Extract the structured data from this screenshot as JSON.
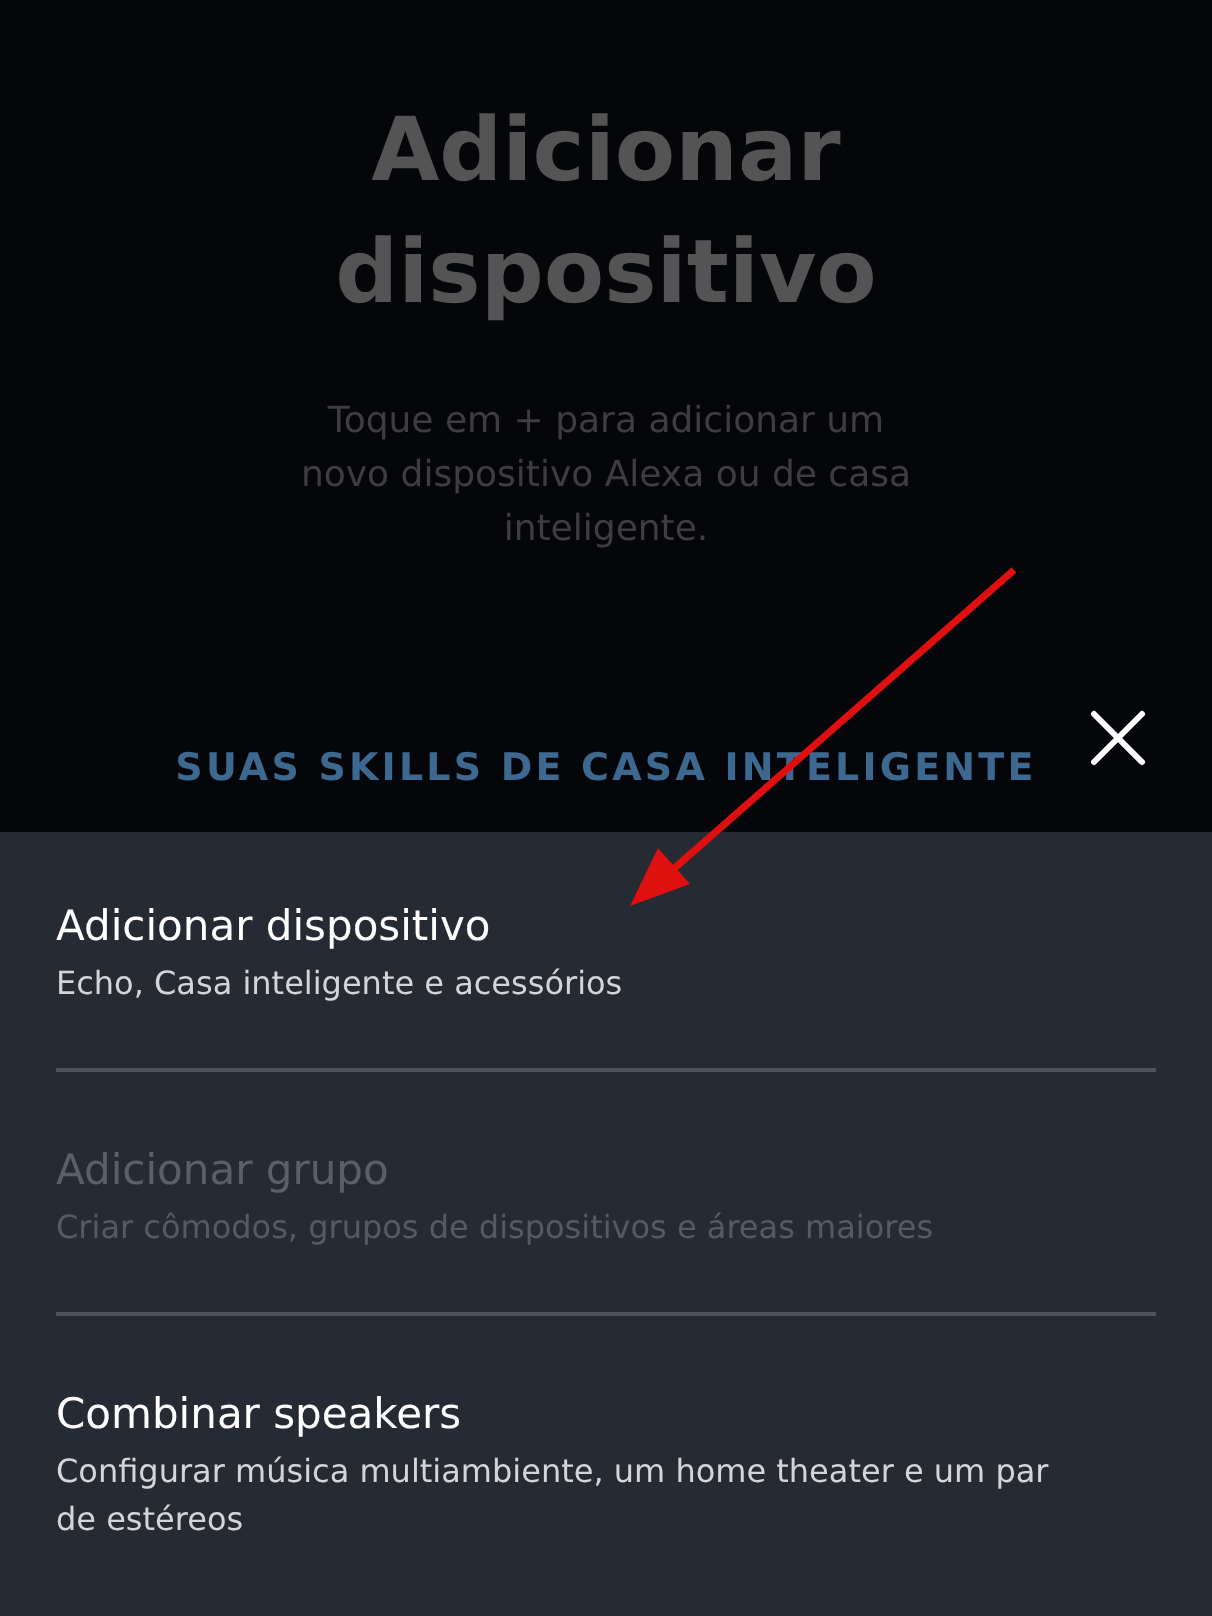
{
  "header": {
    "title": "Adicionar dispositivo",
    "subtitle": "Toque em + para adicionar um novo dispositivo Alexa ou de casa inteligente.",
    "section_label": "SUAS SKILLS DE CASA INTELIGENTE"
  },
  "menu": {
    "items": [
      {
        "title": "Adicionar dispositivo",
        "description": "Echo, Casa inteligente e acessórios",
        "disabled": false
      },
      {
        "title": "Adicionar grupo",
        "description": "Criar cômodos, grupos de dispositivos e áreas maiores",
        "disabled": true
      },
      {
        "title": "Combinar speakers",
        "description": "Configurar música multiambiente, um home theater e um par de estéreos",
        "disabled": false
      }
    ]
  }
}
